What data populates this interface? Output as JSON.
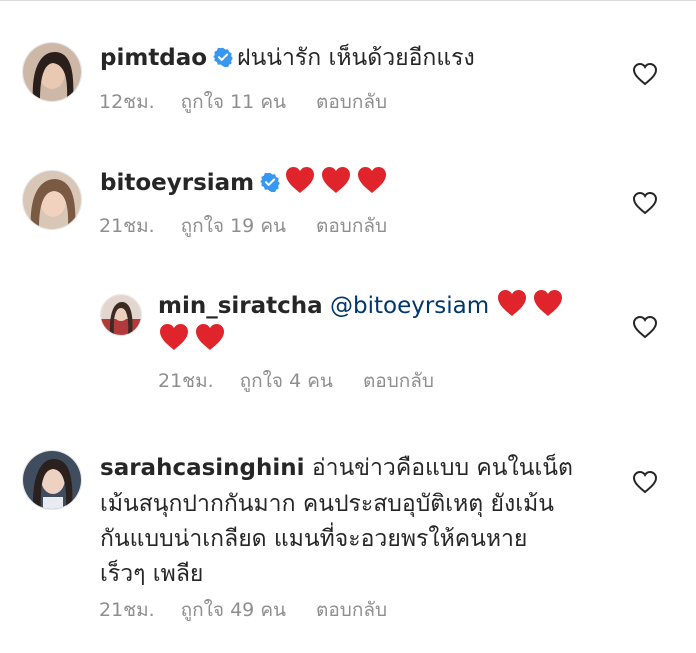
{
  "comments": [
    {
      "username": "pimtdao",
      "verified": true,
      "text": "ฝนน่ารัก เห็นด้วยอีกแรง",
      "time": "12ชม.",
      "likes": "ถูกใจ 11 คน",
      "reply": "ตอบกลับ"
    },
    {
      "username": "bitoeyrsiam",
      "verified": true,
      "hearts": 3,
      "time": "21ชม.",
      "likes": "ถูกใจ 19 คน",
      "reply": "ตอบกลับ"
    },
    {
      "username": "min_siratcha",
      "mention": "@bitoeyrsiam",
      "hearts": 4,
      "time": "21ชม.",
      "likes": "ถูกใจ 4 คน",
      "reply": "ตอบกลับ"
    },
    {
      "username": "sarahcasinghini",
      "text_lines": [
        "อ่านข่าวคือแบบ คนในเน็ต",
        "เม้นสนุกปากกันมาก คนประสบอุบัติเหตุ ยังเม้น",
        "กันแบบน่าเกลียด แมนที่จะอวยพรให้คนหาย",
        "เร็วๆ เพลีย"
      ],
      "time": "21ชม.",
      "likes": "ถูกใจ 49 คน",
      "reply": "ตอบกลับ"
    }
  ],
  "icons": {
    "verified": "verified-badge-icon",
    "heart_emoji": "red-heart-emoji",
    "like": "heart-outline-icon"
  },
  "colors": {
    "verified_blue": "#3897f0",
    "heart_red": "#e0242b",
    "mention": "#00376b",
    "meta_gray": "#8e8e8e"
  }
}
